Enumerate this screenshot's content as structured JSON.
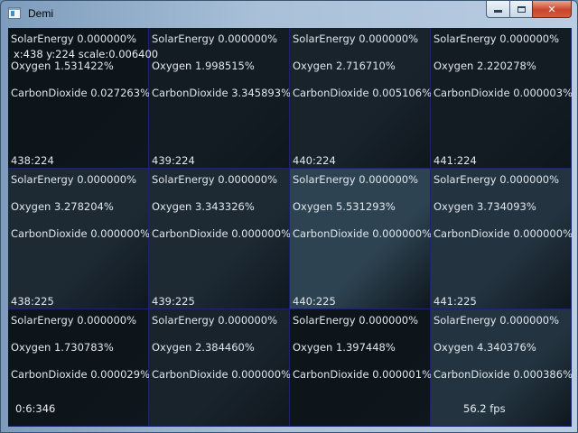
{
  "window": {
    "title": "Demi",
    "minimize_glyph": "minimize-icon",
    "maximize_glyph": "maximize-icon",
    "close_label": "✕"
  },
  "colors": {
    "cell_palette": [
      "#0d141a",
      "#131c23",
      "#19232b",
      "#1d2a34",
      "#233440",
      "#2d4352"
    ]
  },
  "cells": [
    {
      "coord": "438:224",
      "solar": "SolarEnergy  0.000000%",
      "oxygen": "Oxygen  1.531422%",
      "co2": "CarbonDioxide  0.027263%",
      "shade": 0
    },
    {
      "coord": "439:224",
      "solar": "SolarEnergy  0.000000%",
      "oxygen": "Oxygen  1.998515%",
      "co2": "CarbonDioxide  3.345893%",
      "shade": 1
    },
    {
      "coord": "440:224",
      "solar": "SolarEnergy  0.000000%",
      "oxygen": "Oxygen  2.716710%",
      "co2": "CarbonDioxide  0.005106%",
      "shade": 2
    },
    {
      "coord": "441:224",
      "solar": "SolarEnergy  0.000000%",
      "oxygen": "Oxygen  2.220278%",
      "co2": "CarbonDioxide  0.000003%",
      "shade": 1
    },
    {
      "coord": "438:225",
      "solar": "SolarEnergy  0.000000%",
      "oxygen": "Oxygen  3.278204%",
      "co2": "CarbonDioxide  0.000000%",
      "shade": 3
    },
    {
      "coord": "439:225",
      "solar": "SolarEnergy  0.000000%",
      "oxygen": "Oxygen  3.343326%",
      "co2": "CarbonDioxide  0.000000%",
      "shade": 3
    },
    {
      "coord": "440:225",
      "solar": "SolarEnergy  0.000000%",
      "oxygen": "Oxygen  5.531293%",
      "co2": "CarbonDioxide  0.000000%",
      "shade": 5
    },
    {
      "coord": "441:225",
      "solar": "SolarEnergy  0.000000%",
      "oxygen": "Oxygen  3.734093%",
      "co2": "CarbonDioxide  0.000000%",
      "shade": 4
    },
    {
      "coord": "",
      "solar": "SolarEnergy  0.000000%",
      "oxygen": "Oxygen  1.730783%",
      "co2": "CarbonDioxide  0.000029%",
      "shade": 0
    },
    {
      "coord": "",
      "solar": "SolarEnergy  0.000000%",
      "oxygen": "Oxygen  2.384460%",
      "co2": "CarbonDioxide  0.000000%",
      "shade": 2
    },
    {
      "coord": "",
      "solar": "SolarEnergy  0.000000%",
      "oxygen": "Oxygen  1.397448%",
      "co2": "CarbonDioxide  0.000001%",
      "shade": 0
    },
    {
      "coord": "",
      "solar": "SolarEnergy  0.000000%",
      "oxygen": "Oxygen  4.340376%",
      "co2": "CarbonDioxide  0.000386%",
      "shade": 4
    }
  ],
  "overlay": {
    "cursor_info": "x:438 y:224 scale:0.006400",
    "elapsed": "0:6:346",
    "fps": "56.2 fps"
  }
}
